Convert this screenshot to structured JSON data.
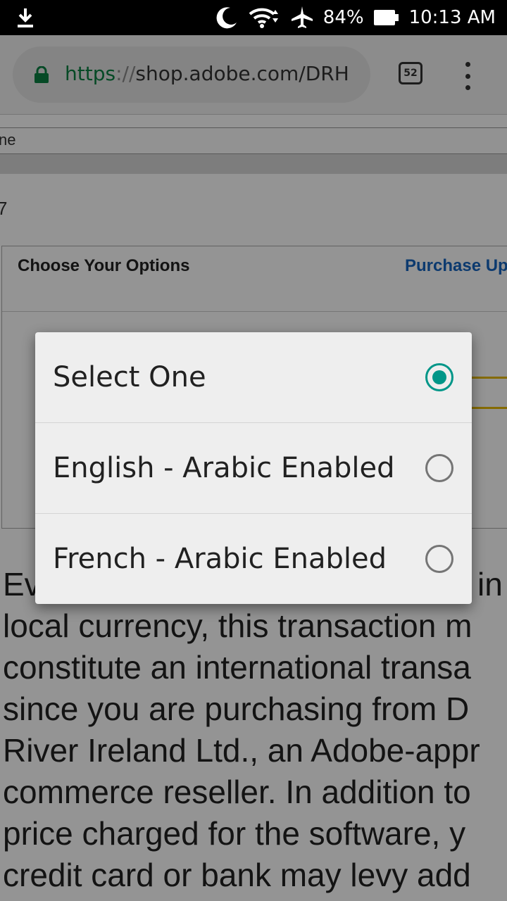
{
  "status_bar": {
    "battery": "84%",
    "time": "10:13 AM",
    "icons": [
      "download-icon",
      "moon-icon",
      "wifi-icon",
      "airplane-icon",
      "battery-icon"
    ]
  },
  "browser": {
    "url_scheme": "https",
    "url_separator": "://",
    "url_rest": "shop.adobe.com/DRH",
    "tab_count": "52"
  },
  "page": {
    "row1_text": "ne",
    "step_text": "7",
    "options_title": "Choose Your Options",
    "purchase_link": "Purchase Up",
    "body_lines": [
      "Ev",
      "local currency, this transaction m",
      "constitute an international transa",
      "since you are purchasing from D",
      "River Ireland Ltd., an Adobe-appr",
      "commerce reseller. In addition to",
      "price charged for the software, y",
      "credit card or bank may levy add"
    ],
    "body_line1_tail": "in"
  },
  "dialog": {
    "options": [
      {
        "label": "Select One",
        "selected": true
      },
      {
        "label": "English - Arabic Enabled",
        "selected": false
      },
      {
        "label": "French - Arabic Enabled",
        "selected": false
      }
    ]
  },
  "colors": {
    "accent": "#009688",
    "link": "#1565c0",
    "secure": "#0b8043"
  }
}
